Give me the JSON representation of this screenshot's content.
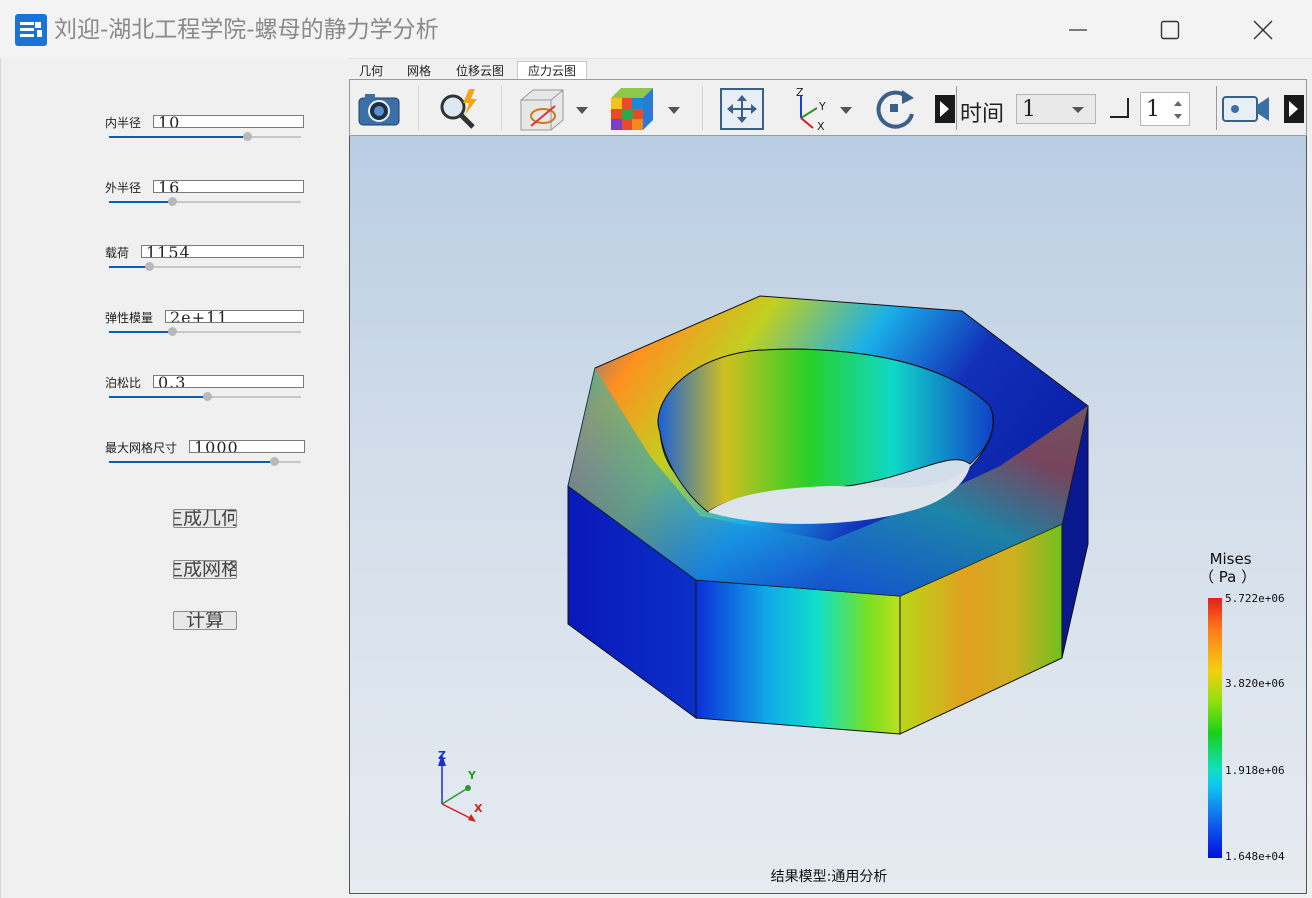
{
  "window": {
    "title": "刘迎-湖北工程学院-螺母的静力学分析",
    "accent_color": "#1a73d9"
  },
  "params": [
    {
      "label": "内半径",
      "value": "10",
      "fraction": 0.72
    },
    {
      "label": "外半径",
      "value": "16",
      "fraction": 0.33
    },
    {
      "label": "载荷",
      "value": "1154",
      "fraction": 0.21
    },
    {
      "label": "弹性模量",
      "value": "2e+11",
      "fraction": 0.33
    },
    {
      "label": "泊松比",
      "value": "0.3",
      "fraction": 0.51
    },
    {
      "label": "最大网格尺寸",
      "value": "1000",
      "fraction": 0.86
    }
  ],
  "buttons": {
    "gen_geometry": "生成几何",
    "gen_mesh": "生成网格",
    "compute": "计算"
  },
  "tabs": [
    "几何",
    "网格",
    "位移云图",
    "应力云图"
  ],
  "active_tab": "应力云图",
  "toolbar": {
    "time_label": "时间",
    "time_value": "1",
    "step_value": "1",
    "icons": [
      "camera-icon",
      "probe-icon",
      "visibility-icon",
      "color-cube-icon",
      "fit-view-icon",
      "axes-icon",
      "rotate-icon",
      "video-camera-icon"
    ]
  },
  "viewport": {
    "legend_title": "Mises",
    "legend_unit": "（ Pa ）",
    "legend_values": [
      "5.722e+06",
      "3.820e+06",
      "1.918e+06",
      "1.648e+04"
    ],
    "model_label": "结果模型:通用分析",
    "triad": {
      "z": "Z",
      "y": "Y",
      "x": "X"
    }
  }
}
